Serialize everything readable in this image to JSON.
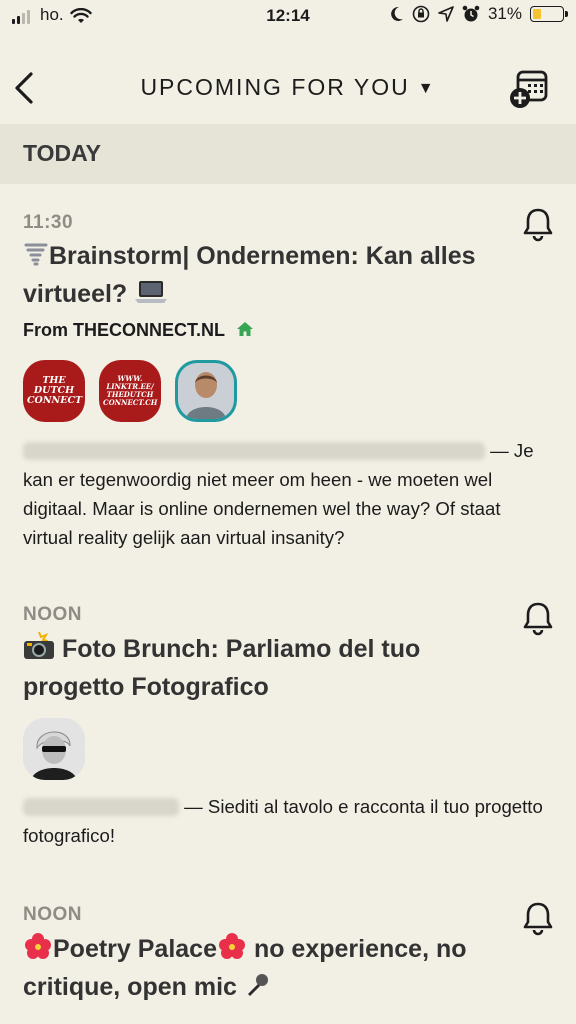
{
  "status_bar": {
    "carrier": "ho.",
    "time": "12:14",
    "battery": "31%",
    "battery_level": 0.31
  },
  "header": {
    "title": "UPCOMING FOR YOU",
    "caret": "▼"
  },
  "section": {
    "label": "TODAY"
  },
  "events": [
    {
      "time": "11:30",
      "title_before": "Brainstorm| Ondernemen: Kan alles virtueel?",
      "club_prefix": "From ",
      "club_name": "THECONNECT.NL",
      "avatar_1_text": "THE DUTCH CONNECT",
      "avatar_2_text": "WWW. LINKTR.EE/ THEDUTCH CONNECT.CH",
      "description": "— Je kan er tegenwoordig niet meer om heen - we moeten wel digitaal. Maar is online ondernemen wel the way? Of staat virtual reality gelijk aan virtual insanity?"
    },
    {
      "time": "NOON",
      "title": "Foto Brunch: Parliamo del tuo progetto Fotografico",
      "description": "— Siediti al tavolo e racconta il tuo progetto fotografico!"
    },
    {
      "time": "NOON",
      "title_part1": "Poetry Palace",
      "title_part2": " no experience, no critique, open mic"
    }
  ]
}
